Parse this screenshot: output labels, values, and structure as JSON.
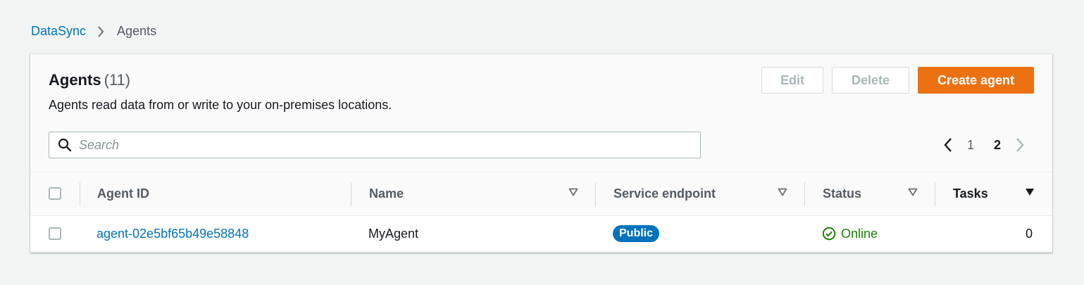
{
  "breadcrumb": {
    "root": "DataSync",
    "current": "Agents"
  },
  "panel": {
    "title": "Agents",
    "count": "(11)",
    "description": "Agents read data from or write to your on-premises locations."
  },
  "actions": {
    "edit": "Edit",
    "delete": "Delete",
    "create": "Create agent"
  },
  "search": {
    "placeholder": "Search",
    "value": ""
  },
  "pagination": {
    "pages": [
      "1",
      "2"
    ],
    "current_page": "2"
  },
  "table": {
    "columns": [
      "Agent ID",
      "Name",
      "Service endpoint",
      "Status",
      "Tasks"
    ],
    "rows": [
      {
        "agent_id": "agent-02e5bf65b49e58848",
        "name": "MyAgent",
        "service_endpoint": "Public",
        "status": "Online",
        "tasks": "0"
      }
    ]
  },
  "colors": {
    "link": "#0073bb",
    "primary_button": "#ec7211",
    "status_online": "#1d8102",
    "badge": "#0073bb"
  },
  "icons": {
    "breadcrumb_separator": "chevron-right-icon",
    "search": "search-icon",
    "prev_page": "chevron-left-icon",
    "next_page": "chevron-right-icon",
    "sort_inactive": "caret-down-outline-icon",
    "sort_active": "caret-down-filled-icon",
    "status": "check-circle-icon"
  }
}
